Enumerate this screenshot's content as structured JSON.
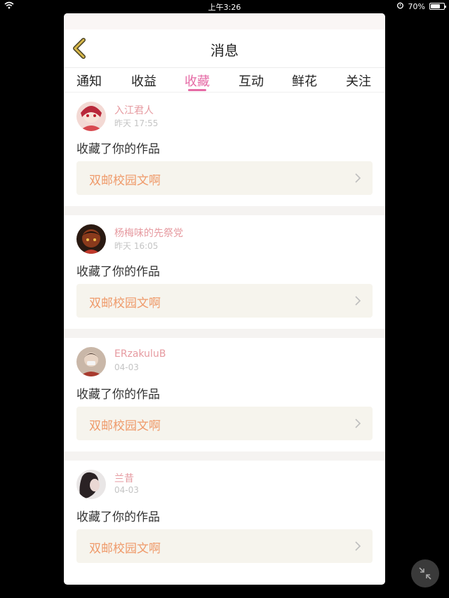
{
  "status_bar": {
    "time": "上午3:26",
    "battery": "70%",
    "battery_level": 0.7
  },
  "navbar": {
    "title": "消息",
    "back_icon": "chevron-left-icon"
  },
  "tabs": [
    {
      "label": "通知"
    },
    {
      "label": "收益"
    },
    {
      "label": "收藏",
      "active": true
    },
    {
      "label": "互动"
    },
    {
      "label": "鲜花"
    },
    {
      "label": "关注"
    }
  ],
  "feed": [
    {
      "username": "入江君人",
      "time": "昨天 17:55",
      "action": "收藏了你的作品",
      "work_title": "双邮校园文啊"
    },
    {
      "username": "杨梅味的先祭党",
      "time": "昨天 16:05",
      "action": "收藏了你的作品",
      "work_title": "双邮校园文啊"
    },
    {
      "username": "ERzakuluB",
      "time": "04-03",
      "action": "收藏了你的作品",
      "work_title": "双邮校园文啊"
    },
    {
      "username": "兰昔",
      "time": "04-03",
      "action": "收藏了你的作品",
      "work_title": "双邮校园文啊"
    }
  ],
  "colors": {
    "accent": "#e56aa5",
    "username": "#e69aa0",
    "work_title": "#ef9a6a",
    "back_arrow": "#d8b84a"
  }
}
